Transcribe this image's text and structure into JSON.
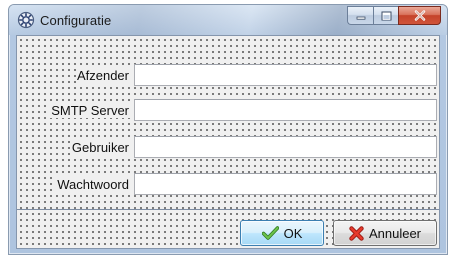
{
  "window": {
    "title": "Configuratie"
  },
  "form": {
    "fields": [
      {
        "label": "Afzender",
        "value": ""
      },
      {
        "label": "SMTP Server",
        "value": ""
      },
      {
        "label": "Gebruiker",
        "value": ""
      },
      {
        "label": "Wachtwoord",
        "value": ""
      }
    ]
  },
  "buttons": {
    "ok": {
      "label": "OK",
      "icon": "checkmark-icon",
      "color": "#4aa33a"
    },
    "cancel": {
      "label": "Annuleer",
      "icon": "red-x-icon",
      "color": "#d9261c"
    }
  },
  "icons": {
    "app": "gear-people-icon",
    "minimize": "minimize-icon",
    "maximize": "maximize-icon",
    "close": "close-icon"
  },
  "colors": {
    "close_button": "#c4432a",
    "ok_button_border": "#3c7fb1"
  }
}
